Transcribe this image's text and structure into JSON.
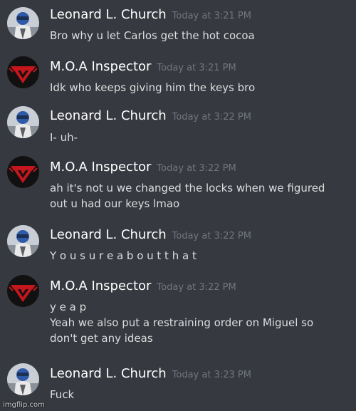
{
  "users": {
    "leonard": {
      "name": "Leonard L. Church",
      "color": "#ffffff"
    },
    "moa": {
      "name": "M.O.A Inspector",
      "color": "#ffffff"
    }
  },
  "messages": [
    {
      "author": "Leonard L. Church",
      "avatar_icon": "leonard-avatar-icon",
      "time": "Today at 3:21 PM",
      "lines": [
        "Bro why u let Carlos get the hot cocoa"
      ]
    },
    {
      "author": "M.O.A Inspector",
      "avatar_icon": "moa-emblem-avatar-icon",
      "time": "Today at 3:21 PM",
      "lines": [
        "Idk who keeps giving him the keys bro"
      ]
    },
    {
      "author": "Leonard L. Church",
      "avatar_icon": "leonard-avatar-icon",
      "time": "Today at 3:22 PM",
      "lines": [
        "I- uh-"
      ]
    },
    {
      "author": "M.O.A Inspector",
      "avatar_icon": "moa-emblem-avatar-icon",
      "time": "Today at 3:22 PM",
      "lines": [
        "ah it's not u we changed the locks when we figured",
        "out u had our keys lmao"
      ]
    },
    {
      "author": "Leonard L. Church",
      "avatar_icon": "leonard-avatar-icon",
      "time": "Today at 3:22 PM",
      "lines": [
        "Y o u s u r e a b o u t t h a t"
      ]
    },
    {
      "author": "M.O.A Inspector",
      "avatar_icon": "moa-emblem-avatar-icon",
      "time": "Today at 3:22 PM",
      "lines": [
        "y e a p",
        "Yeah we also put a restraining order on Miguel so",
        "don't get any ideas"
      ]
    },
    {
      "author": "Leonard L. Church",
      "avatar_icon": "leonard-avatar-icon",
      "time": "Today at 3:23 PM",
      "lines": [
        "Fuck"
      ]
    }
  ],
  "watermark": "imgflip.com",
  "colors": {
    "background": "#36393f",
    "username": "#ffffff",
    "timestamp": "#72767d",
    "message_text": "#dcddde",
    "moa_red": "#c4161c"
  }
}
